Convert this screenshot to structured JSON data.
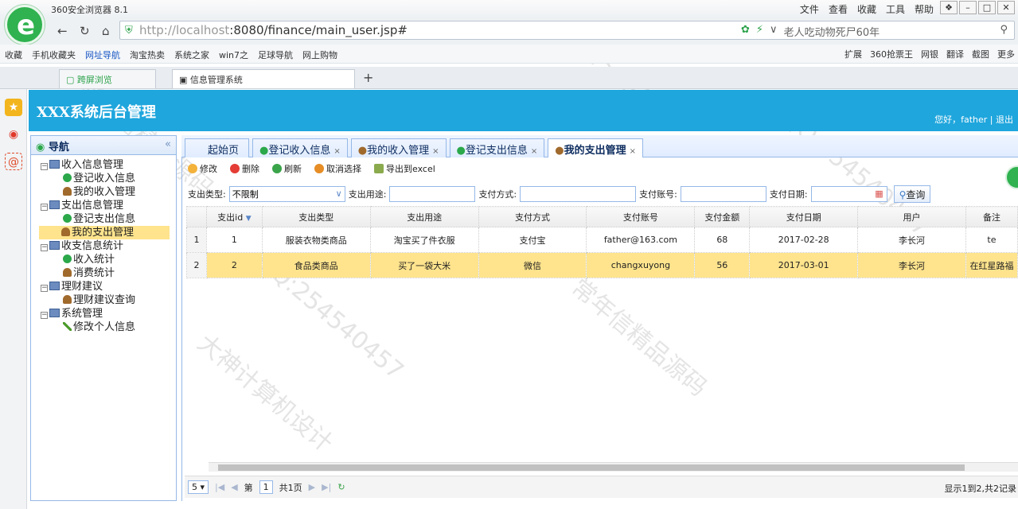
{
  "browser": {
    "title": "360安全浏览器 8.1",
    "menu": [
      "文件",
      "查看",
      "收藏",
      "工具",
      "帮助"
    ],
    "url_host": "http://localhost",
    "url_rest": ":8080/finance/main_user.jsp#",
    "search_text": "老人吃动物死尸60年",
    "favorites": [
      "收藏",
      "手机收藏夹",
      "网址导航",
      "淘宝热卖",
      "系统之家",
      "win7之",
      "足球导航",
      "网上购物"
    ],
    "fav_right": [
      "扩展",
      "360抢票王",
      "网银",
      "翻译",
      "截图",
      "更多"
    ],
    "tabs": [
      "跨屏浏览",
      "信息管理系统"
    ]
  },
  "app": {
    "title": "XXX系统后台管理",
    "greeting": "您好，father",
    "separator": "|",
    "logout": "退出"
  },
  "nav": {
    "title": "导航",
    "collapse": "«",
    "groups": [
      {
        "label": "收入信息管理",
        "items": [
          "登记收入信息",
          "我的收入管理"
        ]
      },
      {
        "label": "支出信息管理",
        "items": [
          "登记支出信息",
          "我的支出管理"
        ]
      },
      {
        "label": "收支信息统计",
        "items": [
          "收入统计",
          "消费统计"
        ]
      },
      {
        "label": "理财建议",
        "items": [
          "理财建议查询"
        ]
      },
      {
        "label": "系统管理",
        "items": [
          "修改个人信息"
        ]
      }
    ]
  },
  "tabs": [
    {
      "label": "起始页"
    },
    {
      "label": "登记收入信息"
    },
    {
      "label": "我的收入管理"
    },
    {
      "label": "登记支出信息"
    },
    {
      "label": "我的支出管理"
    }
  ],
  "toolbar": {
    "edit": "修改",
    "delete": "删除",
    "refresh": "刷新",
    "unselect": "取消选择",
    "export": "导出到excel"
  },
  "filter": {
    "type_label": "支出类型:",
    "type_value": "不限制",
    "purpose_label": "支出用途:",
    "method_label": "支付方式:",
    "account_label": "支付账号:",
    "date_label": "支付日期:",
    "query": "查询"
  },
  "grid": {
    "columns": [
      "支出id",
      "支出类型",
      "支出用途",
      "支付方式",
      "支付账号",
      "支付金额",
      "支付日期",
      "用户",
      "备注"
    ],
    "rows": [
      {
        "rn": "1",
        "id": "1",
        "type": "服装衣物类商品",
        "purpose": "淘宝买了件衣服",
        "method": "支付宝",
        "account": "father@163.com",
        "amount": "68",
        "date": "2017-02-28",
        "user": "李长河",
        "note": "te"
      },
      {
        "rn": "2",
        "id": "2",
        "type": "食品类商品",
        "purpose": "买了一袋大米",
        "method": "微信",
        "account": "changxuyong",
        "amount": "56",
        "date": "2017-03-01",
        "user": "李长河",
        "note": "在红星路福"
      }
    ]
  },
  "pager": {
    "size": "5",
    "page_prefix": "第",
    "page": "1",
    "total_pages": "共1页",
    "info": "显示1到2,共2记录"
  },
  "watermarks": [
    "QQ:254540457",
    "大神计算机设计",
    "常年信精品源码"
  ]
}
